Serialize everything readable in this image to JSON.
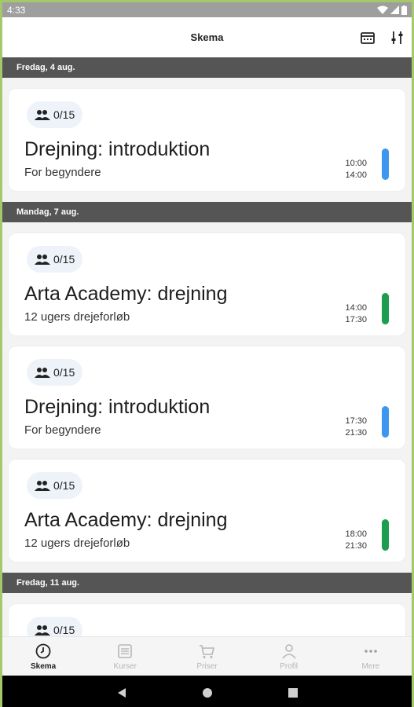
{
  "status": {
    "time": "4:33"
  },
  "app_bar": {
    "title": "Skema"
  },
  "days": [
    {
      "label": "Fredag, 4 aug.",
      "events": [
        {
          "capacity": "0/15",
          "title": "Drejning: introduktion",
          "subtitle": "For begyndere",
          "start": "10:00",
          "end": "14:00",
          "color": "#3d96ef"
        }
      ]
    },
    {
      "label": "Mandag, 7 aug.",
      "events": [
        {
          "capacity": "0/15",
          "title": "Arta Academy: drejning",
          "subtitle": "12 ugers drejeforløb",
          "start": "14:00",
          "end": "17:30",
          "color": "#1c9d4f"
        },
        {
          "capacity": "0/15",
          "title": "Drejning: introduktion",
          "subtitle": "For begyndere",
          "start": "17:30",
          "end": "21:30",
          "color": "#3d96ef"
        },
        {
          "capacity": "0/15",
          "title": "Arta Academy: drejning",
          "subtitle": "12 ugers drejeforløb",
          "start": "18:00",
          "end": "21:30",
          "color": "#1c9d4f"
        }
      ]
    },
    {
      "label": "Fredag, 11 aug.",
      "events": [
        {
          "capacity": "0/15"
        }
      ]
    }
  ],
  "bottom_nav": {
    "items": [
      {
        "label": "Skema",
        "icon": "clock-icon",
        "active": true
      },
      {
        "label": "Kurser",
        "icon": "book-icon",
        "active": false
      },
      {
        "label": "Priser",
        "icon": "cart-icon",
        "active": false
      },
      {
        "label": "Profil",
        "icon": "person-icon",
        "active": false
      },
      {
        "label": "Mere",
        "icon": "more-icon",
        "active": false
      }
    ]
  }
}
